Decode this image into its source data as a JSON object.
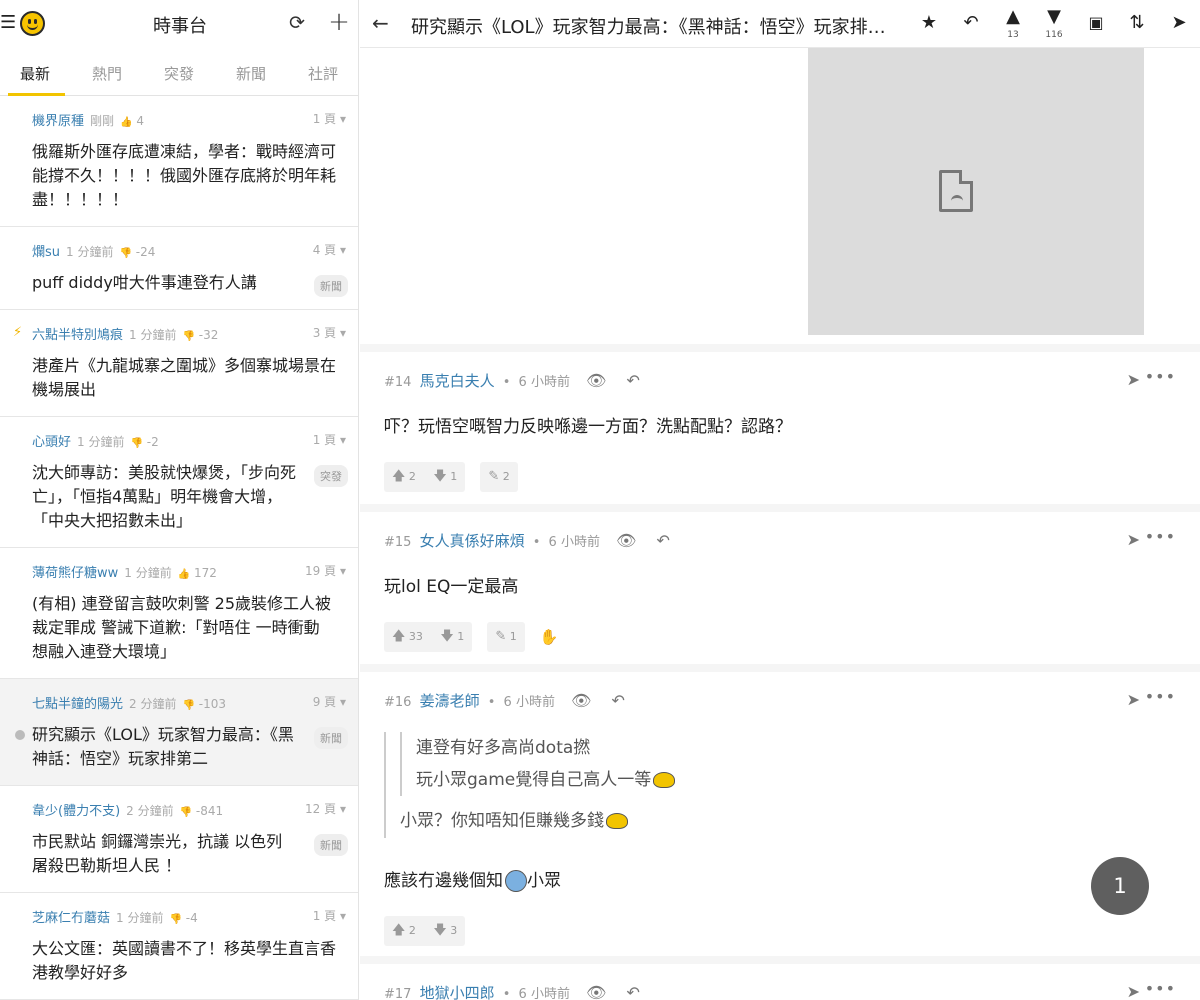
{
  "left": {
    "title": "時事台",
    "tabs": [
      "最新",
      "熱門",
      "突發",
      "新聞",
      "社評"
    ],
    "threads": [
      {
        "author": "機界原種",
        "ago": "剛剛",
        "score": "4",
        "score_dir": "up",
        "pages": "1 頁",
        "title": "俄羅斯外匯存底遭凍結，學者：戰時經濟可能撐不久！！！！俄國外匯存底將於明年耗盡！！！！！",
        "tag": "",
        "bolt": false,
        "current": false
      },
      {
        "author": "爛su",
        "ago": "1 分鐘前",
        "score": "-24",
        "score_dir": "down",
        "pages": "4 頁",
        "title": "puff diddy咁大件事連登冇人講",
        "tag": "新聞",
        "bolt": false,
        "current": false
      },
      {
        "author": "六點半特別鳩痕",
        "ago": "1 分鐘前",
        "score": "-32",
        "score_dir": "down",
        "pages": "3 頁",
        "title": "港產片《九龍城寨之圍城》多個寨城場景在機場展出",
        "tag": "",
        "bolt": true,
        "current": false
      },
      {
        "author": "心頭好",
        "ago": "1 分鐘前",
        "score": "-2",
        "score_dir": "down",
        "pages": "1 頁",
        "title": "沈大師專訪：美股就快爆煲，「步向死亡」，「恒指4萬點」明年機會大增，「中央大把招數未出」",
        "tag": "突發",
        "bolt": false,
        "current": false
      },
      {
        "author": "薄荷熊仔糖ww",
        "ago": "1 分鐘前",
        "score": "172",
        "score_dir": "up",
        "pages": "19 頁",
        "title": "(有相) 連登留言鼓吹刺警 25歲裝修工人被裁定罪成 警誡下道歉:「對唔住 一時衝動 想融入連登大環境」",
        "tag": "",
        "bolt": false,
        "current": false
      },
      {
        "author": "七點半鐘的陽光",
        "ago": "2 分鐘前",
        "score": "-103",
        "score_dir": "down",
        "pages": "9 頁",
        "title": "研究顯示《LOL》玩家智力最高：《黑神話：悟空》玩家排第二",
        "tag": "新聞",
        "bolt": false,
        "current": true
      },
      {
        "author": "韋少(體力不支)",
        "ago": "2 分鐘前",
        "score": "-841",
        "score_dir": "down",
        "pages": "12 頁",
        "title": "市民默站 銅鑼灣崇光，抗議 以色列 屠殺巴勒斯坦人民 ！",
        "tag": "新聞",
        "bolt": false,
        "current": false
      },
      {
        "author": "芝麻仁冇蘑菇",
        "ago": "1 分鐘前",
        "score": "-4",
        "score_dir": "down",
        "pages": "1 頁",
        "title": "大公文匯：英國讀書不了！移英學生直言香港教學好好多",
        "tag": "",
        "bolt": false,
        "current": false
      }
    ]
  },
  "right": {
    "title": "研究顯示《LOL》玩家智力最高：《黑神話：悟空》玩家排第二",
    "like_count": "13",
    "dislike_count": "116",
    "posts": [
      {
        "num": "#14",
        "name": "馬克白夫人",
        "ago": "6 小時前",
        "body": "吓？玩悟空嘅智力反映喺邊一方面？洗點配點？認路？",
        "up": "2",
        "down": "1",
        "replies": "2"
      },
      {
        "num": "#15",
        "name": "女人真係好麻煩",
        "ago": "6 小時前",
        "body": "玩lol EQ一定最高",
        "up": "33",
        "down": "1",
        "replies": "1"
      },
      {
        "num": "#16",
        "name": "姜濤老師",
        "ago": "6 小時前",
        "quote_inner_1": "連登有好多高尚dota撚",
        "quote_inner_2": "玩小眾game覺得自己高人一等",
        "quote_outer": "小眾？你知唔知佢賺幾多錢",
        "body_a": "應該冇邊幾個知",
        "body_b": "小眾",
        "up": "2",
        "down": "3"
      },
      {
        "num": "#17",
        "name": "地獄小四郎",
        "ago": "6 小時前"
      }
    ],
    "page_button": "1"
  },
  "colors": {
    "accent": "#f2c400",
    "link": "#3a7fb0",
    "fab": "#5f5f5f"
  }
}
